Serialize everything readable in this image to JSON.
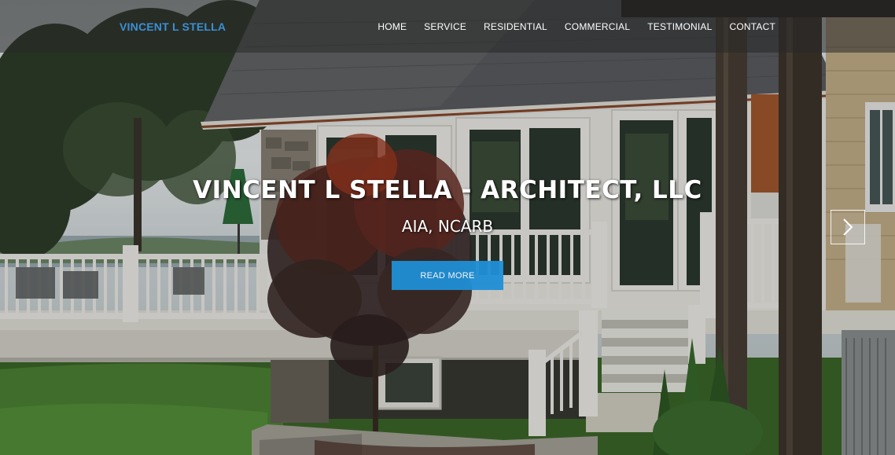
{
  "brand": {
    "name": "VINCENT L STELLA"
  },
  "nav": {
    "items": [
      "HOME",
      "SERVICE",
      "RESIDENTIAL",
      "COMMERCIAL",
      "TESTIMONIAL",
      "CONTACT"
    ]
  },
  "hero": {
    "title": "VINCENT L STELLA - ARCHITECT, LLC",
    "subtitle": "AIA, NCARB",
    "cta_label": "READ MORE",
    "next_icon": "chevron-right-icon"
  },
  "colors": {
    "brand": "#3b8fd6",
    "cta": "#1f8fd6",
    "nav_text": "#ffffff"
  }
}
